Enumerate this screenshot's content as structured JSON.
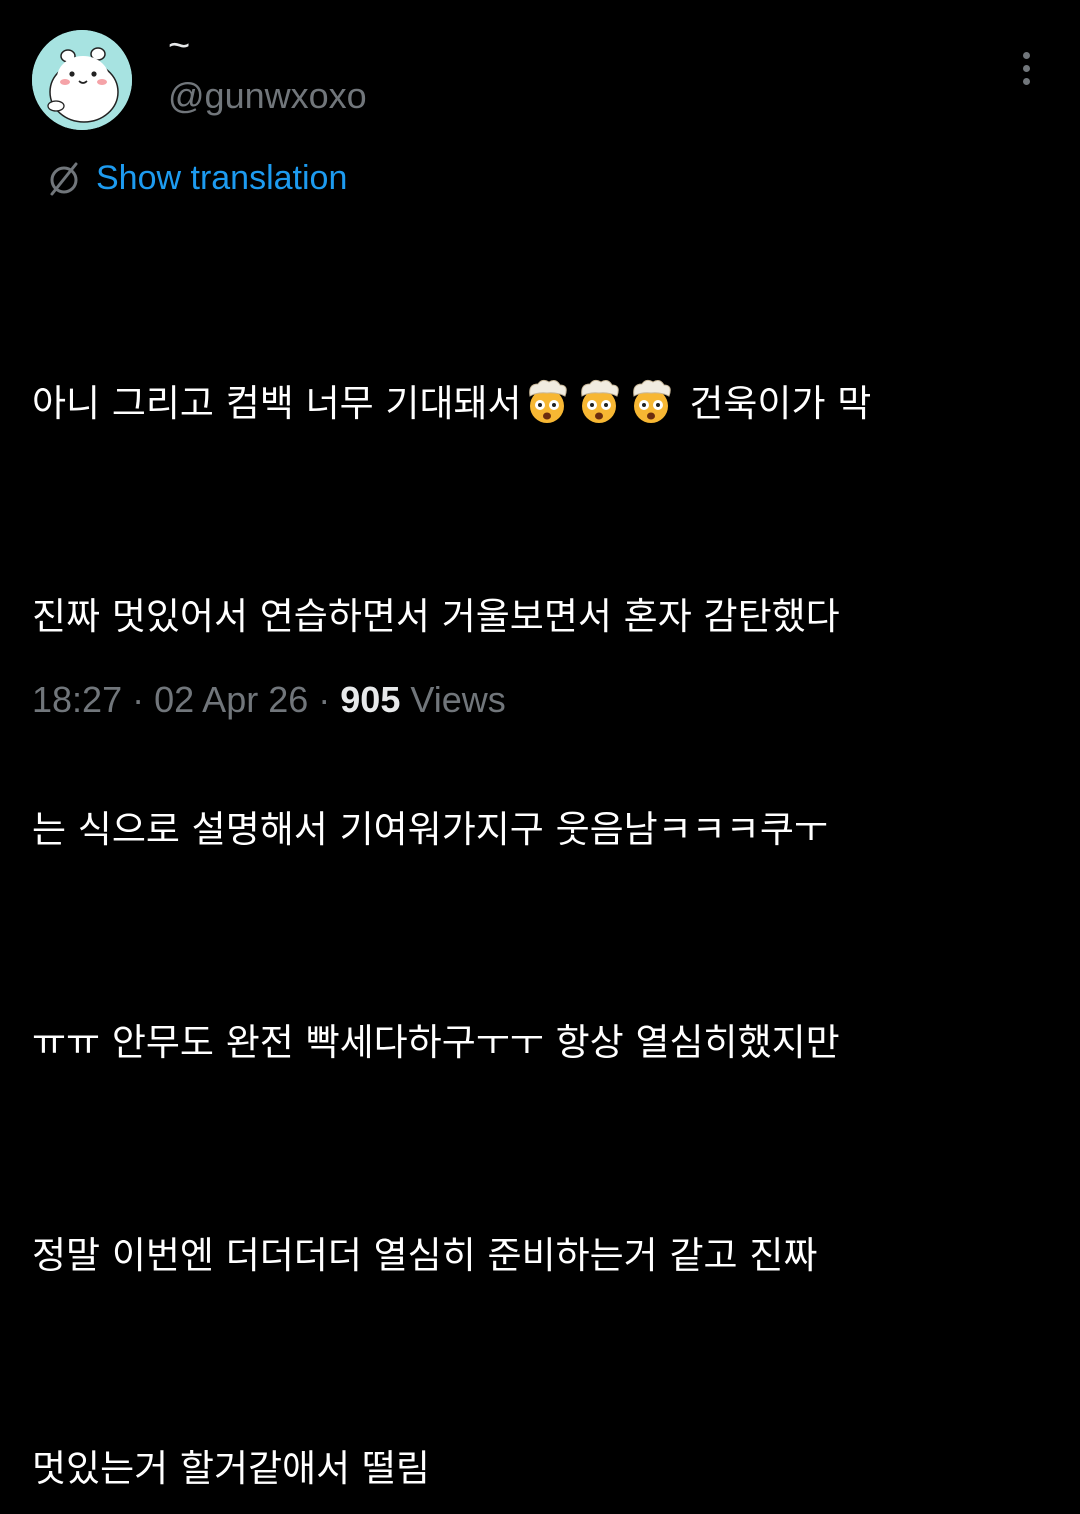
{
  "tweet": {
    "display_name": "~",
    "handle": "@gunwxoxo",
    "avatar_icon": "hamster-character-avatar",
    "more_icon": "more-vertical-icon",
    "translate_icon": "translate-globe-icon",
    "show_translation": "Show translation",
    "text_lines": [
      "아니 그리고 컴백 너무 기대돼서",
      "건욱이가 막",
      "진짜 멋있어서 연습하면서 거울보면서 혼자 감탄했다",
      "는 식으로 설명해서 기여워가지구 웃음남ㅋㅋㅋ쿠ㅜ",
      "ㅠㅠ 안무도 완전 빡세다하구ㅜㅜ 항상 열심히했지만",
      "정말 이번엔 더더더더 열심히 준비하는거 같고 진짜",
      "멋있는거 할거같애서 떨림"
    ],
    "emoji": "exploding-head-emoji",
    "emoji_count": 3,
    "time": "18:27",
    "separator": "·",
    "date": "02 Apr 26",
    "views_count": "905",
    "views_label": "Views"
  },
  "colors": {
    "background": "#000000",
    "link": "#1d9bf0",
    "secondary_text": "#71767b",
    "primary_text": "#e7e9ea",
    "avatar_bg": "#a7e3e1"
  }
}
